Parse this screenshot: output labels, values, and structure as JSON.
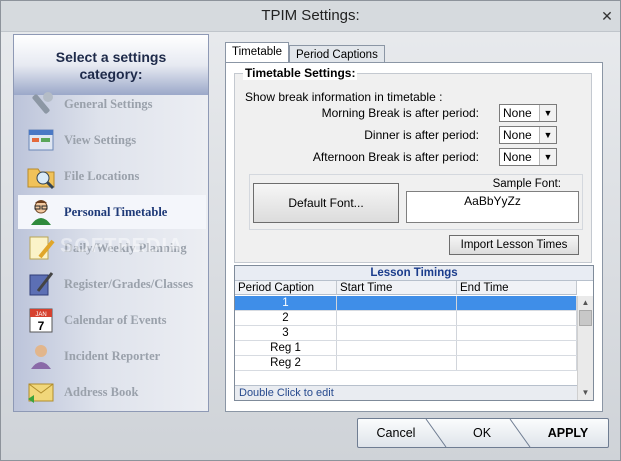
{
  "window": {
    "title": "TPIM Settings:"
  },
  "sidebar": {
    "header": "Select a settings category:",
    "watermark": "SOFTPEDIA",
    "items": [
      {
        "label": "General Settings",
        "icon": "wrench-icon"
      },
      {
        "label": "View Settings",
        "icon": "window-icon"
      },
      {
        "label": "File Locations",
        "icon": "folder-search-icon"
      },
      {
        "label": "Personal Timetable",
        "icon": "person-icon",
        "active": true
      },
      {
        "label": "Daily/Weekly Planning",
        "icon": "pencil-note-icon"
      },
      {
        "label": "Register/Grades/Classes",
        "icon": "book-pen-icon"
      },
      {
        "label": "Calendar of Events",
        "icon": "calendar-icon"
      },
      {
        "label": "Incident Reporter",
        "icon": "user-icon"
      },
      {
        "label": "Address Book",
        "icon": "envelope-icon"
      }
    ]
  },
  "tabs": [
    {
      "label": "Timetable",
      "active": true
    },
    {
      "label": "Period Captions",
      "active": false
    }
  ],
  "timetable": {
    "group_title": "Timetable Settings:",
    "show_label": "Show break information in timetable :",
    "breaks": [
      {
        "label": "Morning Break is after period:",
        "value": "None"
      },
      {
        "label": "Dinner is after period:",
        "value": "None"
      },
      {
        "label": "Afternoon Break is after period:",
        "value": "None"
      }
    ],
    "default_font_label": "Default Font...",
    "sample_font_label": "Sample Font:",
    "sample_text": "AaBbYyZz",
    "import_label": "Import Lesson Times"
  },
  "grid": {
    "title": "Lesson Timings",
    "columns": [
      "Period Caption",
      "Start Time",
      "End Time"
    ],
    "rows": [
      {
        "caption": "1",
        "start": "",
        "end": "",
        "selected": true
      },
      {
        "caption": "2",
        "start": "",
        "end": ""
      },
      {
        "caption": "3",
        "start": "",
        "end": ""
      },
      {
        "caption": "Reg 1",
        "start": "",
        "end": ""
      },
      {
        "caption": "Reg 2",
        "start": "",
        "end": ""
      }
    ],
    "footer": "Double Click to edit"
  },
  "footer": {
    "cancel": "Cancel",
    "ok": "OK",
    "apply": "APPLY"
  },
  "colors": {
    "selection": "#3f8ee8",
    "active_label": "#1f3a78",
    "muted_label": "#9aa1ab"
  }
}
